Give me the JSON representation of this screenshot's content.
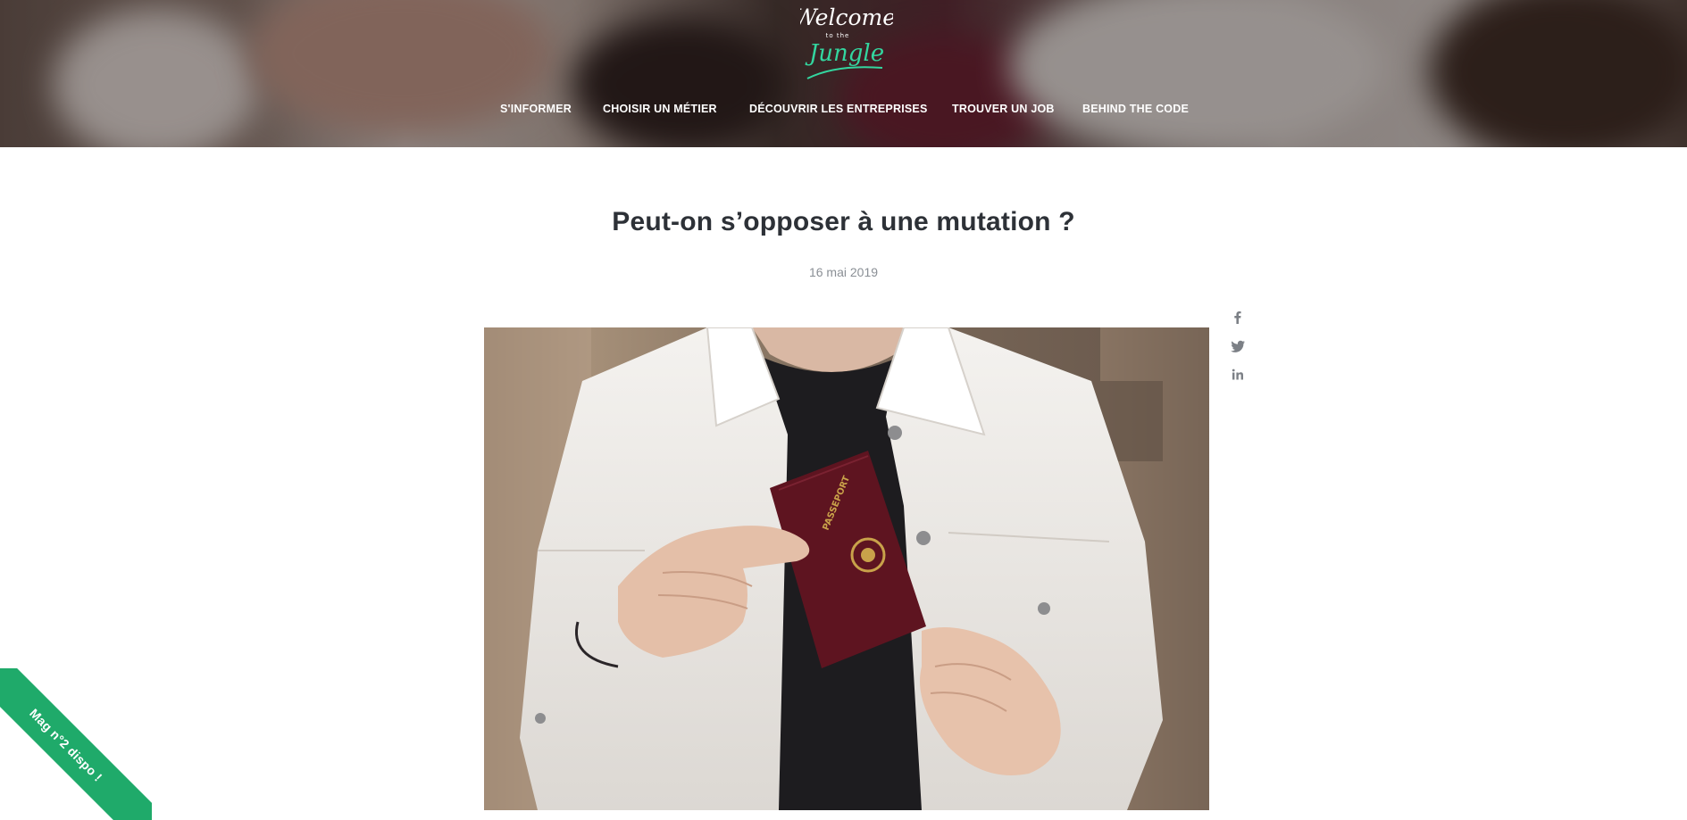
{
  "header": {
    "logo": {
      "line1": "Welcome",
      "line2": "to the",
      "line3": "Jungle"
    },
    "nav": [
      {
        "label": "S'INFORMER"
      },
      {
        "label": "CHOISIR UN MÉTIER"
      },
      {
        "label": "DÉCOUVRIR LES ENTREPRISES"
      },
      {
        "label": "TROUVER UN JOB"
      },
      {
        "label": "BEHIND THE CODE"
      }
    ]
  },
  "article": {
    "title": "Peut-on s’opposer à une mutation ?",
    "date": "16 mai 2019",
    "share": [
      {
        "icon": "facebook-icon"
      },
      {
        "icon": "twitter-icon"
      },
      {
        "icon": "linkedin-icon"
      }
    ],
    "hero_image": {
      "passport_text": "PASSEPORT"
    }
  },
  "ribbon": {
    "label": "Mag n°2 dispo !"
  },
  "colors": {
    "accent_green": "#1faa6a",
    "title": "#2d3137",
    "muted": "#8a8f95",
    "passport": "#5e1420"
  }
}
